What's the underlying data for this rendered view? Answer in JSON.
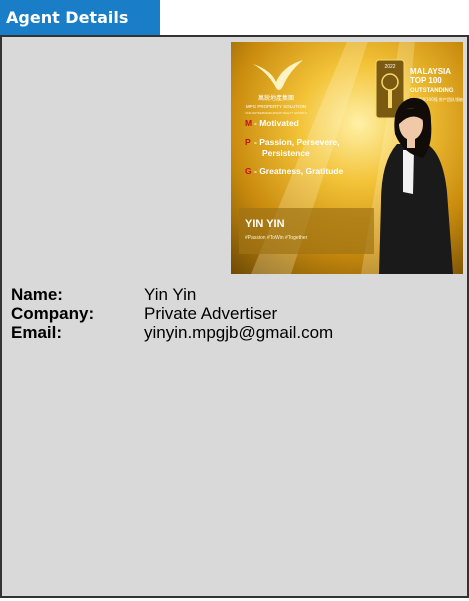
{
  "tab": {
    "label": "Agent Details"
  },
  "photo": {
    "brand_name": "MPG PROPERTY SOLUTION",
    "brand_chinese": "萬鋭地產集團",
    "brand_tagline": "OUR ENTREPRENEURSHIP REALTY GROWTH",
    "award_year": "2022",
    "award_lines": [
      "MALAYSIA",
      "TOP 100",
      "OUTSTANDING"
    ],
    "award_chinese": "马来西亚100强 房产团队领袖",
    "values": [
      {
        "letter": "M",
        "text": "- Motivated"
      },
      {
        "letter": "P",
        "text": "- Passion, Persevere,"
      },
      {
        "letter": "",
        "text": "Persistence"
      },
      {
        "letter": "G",
        "text": "- Greatness, Gratitude"
      }
    ],
    "agent_name": "YIN YIN",
    "hashtags": "#Passion #ToWin #Together"
  },
  "agent": {
    "name_label": "Name:",
    "name": "Yin Yin",
    "company_label": "Company:",
    "company": "Private Advertiser",
    "email_label": "Email:",
    "email": "yinyin.mpgjb@gmail.com"
  }
}
